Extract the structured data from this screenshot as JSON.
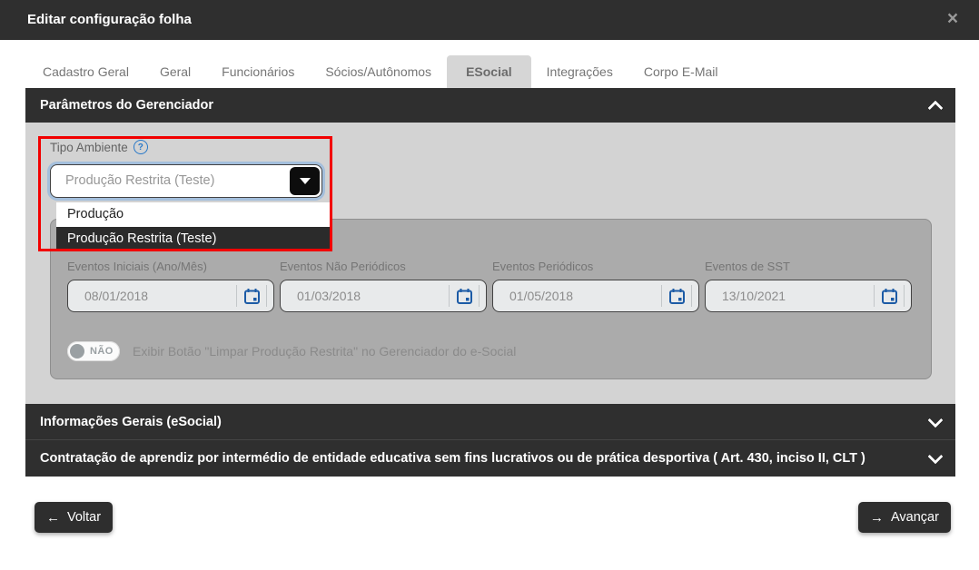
{
  "modal": {
    "title": "Editar configuração folha"
  },
  "icons": {
    "close": "×",
    "help": "?",
    "back_arrow": "←",
    "next_arrow": "→",
    "section_collapse": "chevron-up",
    "accordion_expand": "chevron-down",
    "select_caret": "caret-down",
    "date_picker": "calendar"
  },
  "tabs": [
    {
      "label": "Cadastro Geral",
      "active": false
    },
    {
      "label": "Geral",
      "active": false
    },
    {
      "label": "Funcionários",
      "active": false
    },
    {
      "label": "Sócios/Autônomos",
      "active": false
    },
    {
      "label": "ESocial",
      "active": true
    },
    {
      "label": "Integrações",
      "active": false
    },
    {
      "label": "Corpo E-Mail",
      "active": false
    }
  ],
  "parametros": {
    "title": "Parâmetros do Gerenciador",
    "tipo_ambiente": {
      "label": "Tipo Ambiente",
      "value": "Produção Restrita (Teste)",
      "options": [
        {
          "label": "Produção",
          "highlighted": false
        },
        {
          "label": "Produção Restrita (Teste)",
          "highlighted": true
        }
      ]
    },
    "date_fields": [
      {
        "label": "Eventos Iniciais (Ano/Mês)",
        "value": "08/01/2018"
      },
      {
        "label": "Eventos Não Periódicos",
        "value": "01/03/2018"
      },
      {
        "label": "Eventos Periódicos",
        "value": "01/05/2018"
      },
      {
        "label": "Eventos de SST",
        "value": "13/10/2021"
      }
    ],
    "toggle": {
      "state": "NÃO",
      "label": "Exibir Botão \"Limpar Produção Restrita\" no Gerenciador do e-Social"
    }
  },
  "accordions": [
    {
      "title": "Informações Gerais (eSocial)"
    },
    {
      "title": "Contratação de aprendiz por intermédio de entidade educativa sem fins lucrativos ou de prática desportiva ( Art. 430, inciso II, CLT )"
    }
  ],
  "footer": {
    "back": "Voltar",
    "next": "Avançar"
  },
  "colors": {
    "dark_bar": "#2f2f2f",
    "content_bg": "#d3d3d3",
    "panel_bg": "#ababab",
    "highlight_red": "#f20000",
    "input_bg": "#e8eaeb",
    "calendar_blue": "#1c5ba6",
    "help_blue": "#2979c8",
    "option_selected_bg": "#2b2b2b"
  }
}
